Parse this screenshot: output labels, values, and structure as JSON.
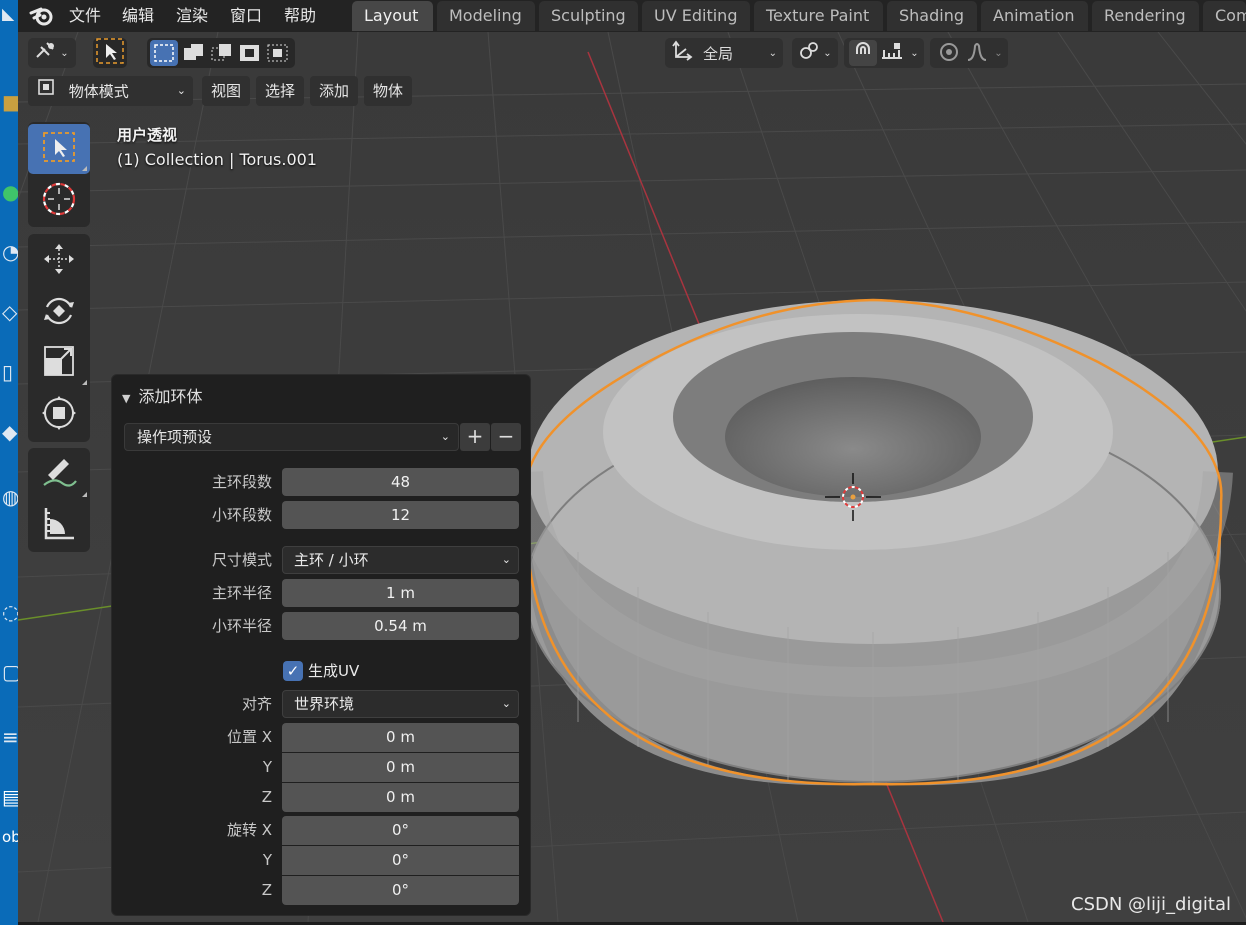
{
  "menu": {
    "items": [
      "文件",
      "编辑",
      "渲染",
      "窗口",
      "帮助"
    ]
  },
  "workspace_tabs": [
    "Layout",
    "Modeling",
    "Sculpting",
    "UV Editing",
    "Texture Paint",
    "Shading",
    "Animation",
    "Rendering",
    "Compositing"
  ],
  "header": {
    "transform_orientation": "全局",
    "mode": "物体模式",
    "menus": [
      "视图",
      "选择",
      "添加",
      "物体"
    ]
  },
  "viewport": {
    "view_name": "用户透视",
    "object_info": "(1) Collection | Torus.001"
  },
  "operator_panel": {
    "title": "添加环体",
    "preset_label": "操作项预设",
    "plus": "+",
    "minus": "−",
    "major_segments_label": "主环段数",
    "major_segments": "48",
    "minor_segments_label": "小环段数",
    "minor_segments": "12",
    "dimensions_mode_label": "尺寸模式",
    "dimensions_mode": "主环 / 小环",
    "major_radius_label": "主环半径",
    "major_radius": "1 m",
    "minor_radius_label": "小环半径",
    "minor_radius": "0.54 m",
    "generate_uv_label": "生成UV",
    "generate_uv": true,
    "align_label": "对齐",
    "align": "世界环境",
    "location_label": "位置 X",
    "loc_y_label": "Y",
    "loc_z_label": "Z",
    "location": [
      "0 m",
      "0 m",
      "0 m"
    ],
    "rotation_label": "旋转 X",
    "rot_y_label": "Y",
    "rot_z_label": "Z",
    "rotation": [
      "0°",
      "0°",
      "0°"
    ]
  },
  "watermark": "CSDN @liji_digital",
  "desktop_strip_fragment": "ob",
  "colors": {
    "selection_outline": "#f0922b",
    "active_blue": "#4772b3",
    "x_axis": "#a8343f",
    "y_axis": "#6a8f2a"
  }
}
